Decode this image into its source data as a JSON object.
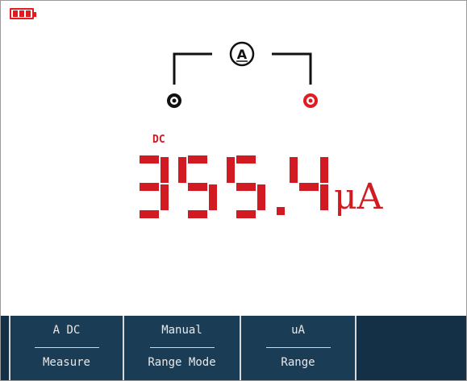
{
  "status": {
    "battery_icon": "battery-full-icon",
    "battery_color": "#e11b22"
  },
  "probe": {
    "meter_symbol": "A",
    "com_terminal_color": "#111111",
    "input_terminal_color": "#e11b22"
  },
  "reading": {
    "mode": "DC",
    "value": "355.4",
    "unit": "μA",
    "color": "#d11a22"
  },
  "softkeys": [
    {
      "value": "A DC",
      "label": "Measure"
    },
    {
      "value": "Manual",
      "label": "Range Mode"
    },
    {
      "value": "uA",
      "label": "Range"
    }
  ],
  "colors": {
    "softbar_bg": "#143046",
    "softkey_bg": "#1b3c55",
    "softkey_text": "#e8e8e8"
  }
}
